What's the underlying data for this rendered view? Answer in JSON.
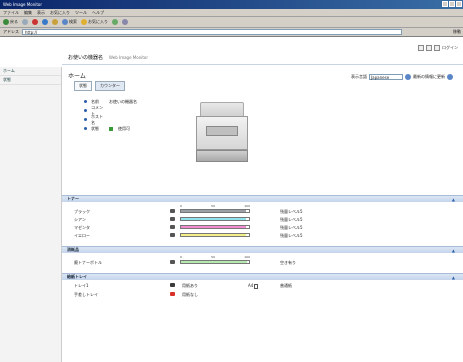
{
  "window": {
    "title": "Web Image Monitor"
  },
  "menubar": [
    "ファイル",
    "編集",
    "表示",
    "お気に入り",
    "ツール",
    "ヘルプ"
  ],
  "toolbar": {
    "back": "戻る",
    "search": "検索",
    "favorites": "お気に入り"
  },
  "address": {
    "label": "アドレス",
    "url": "http://",
    "go": "移動"
  },
  "topright": {
    "logout": "ログイン"
  },
  "sidebar": {
    "items": [
      "ホーム",
      "状態"
    ]
  },
  "header": {
    "title": "お使いの機器名",
    "subtitle": "Web Image Monitor"
  },
  "page": {
    "title": "ホーム",
    "tabs": [
      {
        "label": "状態"
      },
      {
        "label": "カウンター"
      }
    ],
    "lang_label": "表示言語",
    "lang_value": "Japanese",
    "refresh_label": "最新の情報に更新"
  },
  "info": [
    {
      "label": "名前",
      "value": "お使いの機器名"
    },
    {
      "label": "コメント",
      "value": ""
    },
    {
      "label": "ホスト名",
      "value": ""
    },
    {
      "label": "状態",
      "value": "使用可"
    }
  ],
  "sections": {
    "toner": "トナー",
    "consumables": "消耗品",
    "tray": "給紙トレイ",
    "toggle": "▲"
  },
  "scale": [
    "0",
    "50",
    "100"
  ],
  "toner": [
    {
      "name": "ブラック",
      "level": 0.95,
      "color": "#9aa0a6",
      "status": "残量レベル5"
    },
    {
      "name": "シアン",
      "level": 0.95,
      "color": "#8fe3ec",
      "status": "残量レベル5"
    },
    {
      "name": "マゼンタ",
      "level": 0.95,
      "color": "#f08ccf",
      "status": "残量レベル5"
    },
    {
      "name": "イエロー",
      "level": 0.95,
      "color": "#f3f08a",
      "status": "残量レベル5"
    }
  ],
  "consumables": [
    {
      "name": "廃トナーボトル",
      "level": 0.97,
      "color": "#b6e9b0",
      "status": "空き有り"
    }
  ],
  "trays": [
    {
      "name": "トレイ1",
      "status": "用紙あり",
      "icon_color": "#3a3a3a",
      "paper": "A4",
      "size": "普通紙"
    },
    {
      "name": "手差しトレイ",
      "status": "用紙なし",
      "icon_color": "#d9302a",
      "paper": "",
      "size": ""
    }
  ]
}
